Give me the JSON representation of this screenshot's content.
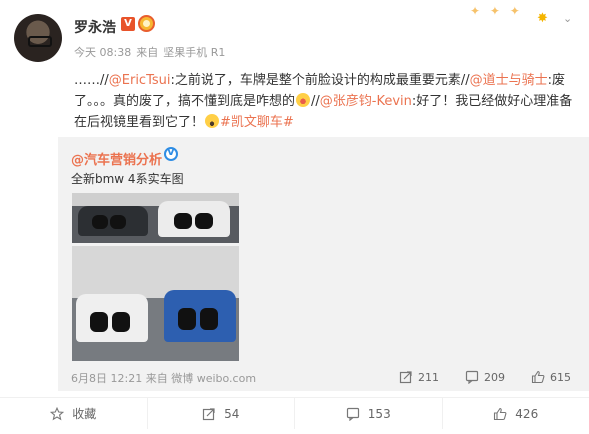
{
  "post": {
    "author": "罗永浩",
    "verified_mark": "V",
    "time": "今天 08:38",
    "source_prefix": "来自",
    "source": "坚果手机 R1",
    "text": {
      "t1": "……//",
      "m1": "@EricTsui",
      "t2": ":之前说了，车牌是整个前脸设计的构成最重要元素//",
      "m2": "@道士与骑士",
      "t3": ":废了。。。真的废了，搞不懂到底是咋想的",
      "t4": "//",
      "m3": "@张彦钧-Kevin",
      "t5": ":好了！我已经做好心理准备在后视镜里看到它了！",
      "topic": "#凯文聊车#"
    }
  },
  "repost": {
    "author": "@汽车营销分析",
    "text": "全新bmw 4系实车图",
    "time": "6月8日 12:21",
    "source_prefix": "来自",
    "source": "微博 weibo.com",
    "stats": {
      "reposts": "211",
      "comments": "209",
      "likes": "615"
    }
  },
  "actions": {
    "favorite": "收藏",
    "repost": "54",
    "comment": "153",
    "like": "426"
  },
  "colors": {
    "link": "#eb7350",
    "badge": "#e8532a",
    "meta": "#999999"
  }
}
